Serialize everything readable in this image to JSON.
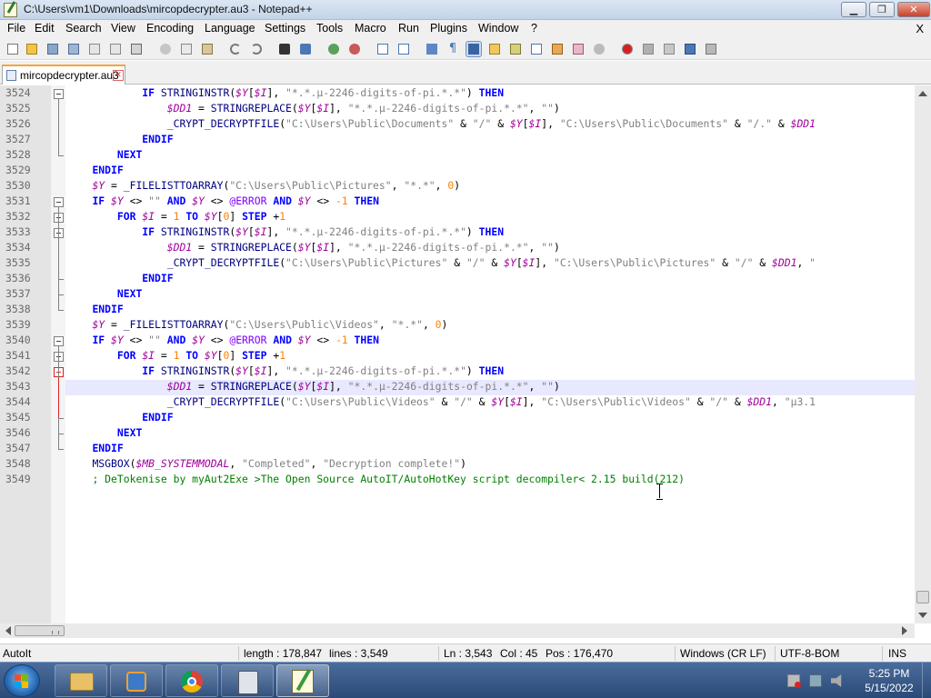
{
  "window": {
    "title": "C:\\Users\\vm1\\Downloads\\mircopdecrypter.au3 - Notepad++",
    "minimize_label": "▁",
    "maximize_label": "❐",
    "close_label": "✕"
  },
  "menu": {
    "items": [
      "File",
      "Edit",
      "Search",
      "View",
      "Encoding",
      "Language",
      "Settings",
      "Tools",
      "Macro",
      "Run",
      "Plugins",
      "Window",
      "?"
    ],
    "close_label": "X"
  },
  "toolbar": {
    "icons": [
      "new-file-icon",
      "open-file-icon",
      "save-icon",
      "save-all-icon",
      "close-icon",
      "close-all-icon",
      "print-icon",
      "cut-icon",
      "copy-icon",
      "paste-icon",
      "undo-icon",
      "redo-icon",
      "find-icon",
      "replace-icon",
      "zoom-in-icon",
      "zoom-out-icon",
      "sync-vertical-icon",
      "sync-horizontal-icon",
      "word-wrap-icon",
      "show-all-chars-icon",
      "indent-guide-icon",
      "user-language-icon",
      "doc-map-icon",
      "function-list-icon",
      "folder-workspace-icon",
      "doc-switcher-icon",
      "monitoring-icon",
      "record-macro-icon",
      "stop-record-icon",
      "play-macro-icon",
      "run-macro-multiple-icon",
      "save-macro-icon"
    ]
  },
  "tab": {
    "label": "mircopdecrypter.au3",
    "close_label": "✕"
  },
  "editor": {
    "current_line": 3543,
    "lines": [
      {
        "no": "3524",
        "text": "            IF STRINGINSTR($Y[$I], \"*.*.µ-2246-digits-of-pi.*.*\") THEN"
      },
      {
        "no": "3525",
        "text": "                $DD1 = STRINGREPLACE($Y[$I], \"*.*.µ-2246-digits-of-pi.*.*\", \"\")"
      },
      {
        "no": "3526",
        "text": "                _CRYPT_DECRYPTFILE(\"C:\\Users\\Public\\Documents\" & \"/\" & $Y[$I], \"C:\\Users\\Public\\Documents\" & \"/.\" & $DD1"
      },
      {
        "no": "3527",
        "text": "            ENDIF"
      },
      {
        "no": "3528",
        "text": "        NEXT"
      },
      {
        "no": "3529",
        "text": "    ENDIF"
      },
      {
        "no": "3530",
        "text": "    $Y = _FILELISTTOARRAY(\"C:\\Users\\Public\\Pictures\", \"*.*\", 0)"
      },
      {
        "no": "3531",
        "text": "    IF $Y <> \"\" AND $Y <> @ERROR AND $Y <> -1 THEN"
      },
      {
        "no": "3532",
        "text": "        FOR $I = 1 TO $Y[0] STEP +1"
      },
      {
        "no": "3533",
        "text": "            IF STRINGINSTR($Y[$I], \"*.*.µ-2246-digits-of-pi.*.*\") THEN"
      },
      {
        "no": "3534",
        "text": "                $DD1 = STRINGREPLACE($Y[$I], \"*.*.µ-2246-digits-of-pi.*.*\", \"\")"
      },
      {
        "no": "3535",
        "text": "                _CRYPT_DECRYPTFILE(\"C:\\Users\\Public\\Pictures\" & \"/\" & $Y[$I], \"C:\\Users\\Public\\Pictures\" & \"/\" & $DD1, \""
      },
      {
        "no": "3536",
        "text": "            ENDIF"
      },
      {
        "no": "3537",
        "text": "        NEXT"
      },
      {
        "no": "3538",
        "text": "    ENDIF"
      },
      {
        "no": "3539",
        "text": "    $Y = _FILELISTTOARRAY(\"C:\\Users\\Public\\Videos\", \"*.*\", 0)"
      },
      {
        "no": "3540",
        "text": "    IF $Y <> \"\" AND $Y <> @ERROR AND $Y <> -1 THEN"
      },
      {
        "no": "3541",
        "text": "        FOR $I = 1 TO $Y[0] STEP +1"
      },
      {
        "no": "3542",
        "text": "            IF STRINGINSTR($Y[$I], \"*.*.µ-2246-digits-of-pi.*.*\") THEN"
      },
      {
        "no": "3543",
        "text": "                $DD1 = STRINGREPLACE($Y[$I], \"*.*.µ-2246-digits-of-pi.*.*\", \"\")"
      },
      {
        "no": "3544",
        "text": "                _CRYPT_DECRYPTFILE(\"C:\\Users\\Public\\Videos\" & \"/\" & $Y[$I], \"C:\\Users\\Public\\Videos\" & \"/\" & $DD1, \"µ3.1"
      },
      {
        "no": "3545",
        "text": "            ENDIF"
      },
      {
        "no": "3546",
        "text": "        NEXT"
      },
      {
        "no": "3547",
        "text": "    ENDIF"
      },
      {
        "no": "3548",
        "text": "    MSGBOX($MB_SYSTEMMODAL, \"Completed\", \"Decryption complete!\")"
      },
      {
        "no": "3549",
        "text": "    ; DeTokenise by myAut2Exe >The Open Source AutoIT/AutoHotKey script decompiler< 2.15 build(212)"
      }
    ]
  },
  "status": {
    "language": "AutoIt",
    "length": "length : 178,847",
    "lines": "lines : 3,549",
    "ln": "Ln : 3,543",
    "col": "Col : 45",
    "pos": "Pos : 176,470",
    "eol": "Windows (CR LF)",
    "encoding": "UTF-8-BOM",
    "mode": "INS"
  },
  "taskbar": {
    "apps": [
      "file-explorer-icon",
      "media-player-icon",
      "chrome-icon",
      "file-manager-icon",
      "notepad-plus-plus-icon"
    ],
    "time": "5:25 PM",
    "date": "5/15/2022"
  }
}
